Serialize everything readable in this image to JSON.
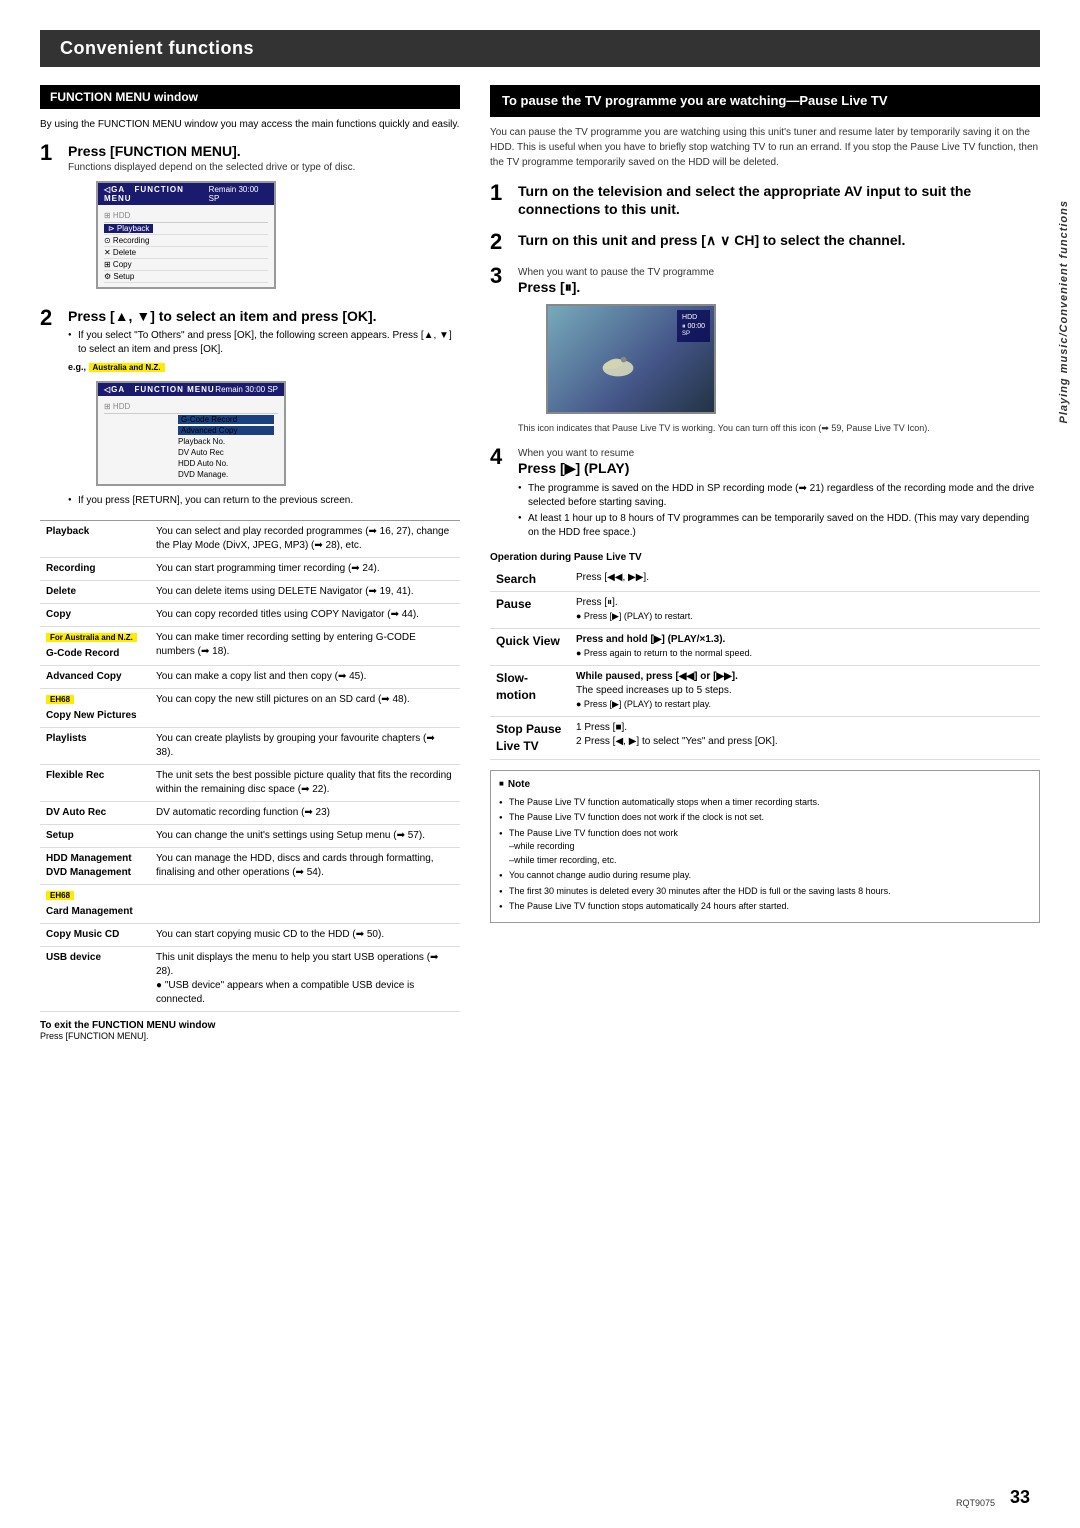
{
  "page": {
    "title": "Convenient functions",
    "page_number": "33",
    "rqt_code": "RQT9075",
    "sidebar_text": "Playing music/Convenient functions"
  },
  "left_section": {
    "heading": "FUNCTION MENU window",
    "intro": "By using the FUNCTION MENU window you may access the main functions quickly and easily.",
    "step1": {
      "number": "1",
      "title": "Press [FUNCTION MENU].",
      "sub": "Functions displayed depend on the selected drive or type of disc."
    },
    "step2": {
      "number": "2",
      "title": "Press [▲, ▼] to select an item and press [OK].",
      "bullet1": "If you select \"To Others\" and press [OK], the following screen appears. Press [▲, ▼] to select an item and press [OK].",
      "eg_label": "e.g., Australia and N.Z.",
      "bullet2": "If you press [RETURN], you can return to the previous screen."
    },
    "screen1": {
      "brand": "◁GA",
      "menu": "FUNCTION MENU",
      "remain": "Remain  30:00 SP",
      "rows": [
        {
          "label": "Playback",
          "highlight": false
        },
        {
          "label": "Recording",
          "highlight": false
        },
        {
          "label": "Delete",
          "highlight": false
        },
        {
          "label": "Copy",
          "highlight": false
        },
        {
          "label": "Setup",
          "highlight": false
        }
      ]
    },
    "screen2": {
      "brand": "◁GA",
      "menu": "FUNCTION MENU",
      "remain": "Remain  30:00 SP",
      "hdd_label": "HDD",
      "rows": [
        {
          "label": "",
          "right_label": "G-Code Record",
          "highlight": false
        },
        {
          "label": "",
          "right_label": "Advanced Copy",
          "highlight_right": true
        },
        {
          "label": "",
          "right_label": "Playback No.",
          "highlight_right": false
        },
        {
          "label": "",
          "right_label": "DV Auto Rec",
          "highlight_right": false
        },
        {
          "label": "",
          "right_label": "HDD Auto No.",
          "highlight_right": false
        },
        {
          "label": "",
          "right_label": "DVD Manage.",
          "highlight_right": false
        }
      ]
    },
    "table": {
      "rows": [
        {
          "label": "Playback",
          "desc": "You can select and play recorded programmes (➡ 16, 27), change the Play Mode (DivX, JPEG, MP3) (➡ 28), etc."
        },
        {
          "label": "Recording",
          "desc": "You can start programming timer recording (➡ 24)."
        },
        {
          "label": "Delete",
          "desc": "You can delete items using DELETE Navigator (➡ 19, 41)."
        },
        {
          "label": "Copy",
          "desc": "You can copy recorded titles using COPY Navigator (➡ 44)."
        },
        {
          "label_special": "For Australia and N.Z.\nG-Code Record",
          "desc": "You can make timer recording setting by entering G-CODE numbers (➡ 18)."
        },
        {
          "label": "Advanced Copy",
          "desc": "You can make a copy list and then copy (➡ 45)."
        },
        {
          "label_special": "EH68\nCopy New Pictures",
          "desc": "You can copy the new still pictures on an SD card (➡ 48)."
        },
        {
          "label": "Playlists",
          "desc": "You can create playlists by grouping your favourite chapters (➡ 38)."
        },
        {
          "label": "Flexible Rec",
          "desc": "The unit sets the best possible picture quality that fits the recording within the remaining disc space (➡ 22)."
        },
        {
          "label": "DV Auto Rec",
          "desc": "DV automatic recording function (➡ 23)"
        },
        {
          "label": "Setup",
          "desc": "You can change the unit's settings using Setup menu (➡ 57)."
        },
        {
          "label": "HDD Management\nDVD Management",
          "desc": "You can manage the HDD, discs and cards through formatting, finalising and other operations (➡ 54)."
        },
        {
          "label_special": "EH68\nCard Management",
          "desc": ""
        },
        {
          "label": "Copy Music CD",
          "desc": "You can start copying music CD to the HDD (➡ 50)."
        },
        {
          "label": "USB device",
          "desc": "This unit displays the menu to help you start USB operations (➡ 28).\n● \"USB device\" appears when a compatible USB device is connected."
        }
      ]
    },
    "footer": {
      "bold": "To exit the FUNCTION MENU window",
      "text": "Press [FUNCTION MENU]."
    }
  },
  "right_section": {
    "heading": "To pause the TV programme you are watching—Pause Live TV",
    "intro": "You can pause the TV programme you are watching using this unit's tuner and resume later by temporarily saving it on the HDD. This is useful when you have to briefly stop watching TV to run an errand. If you stop the Pause Live TV function, then the TV programme temporarily saved on the HDD will be deleted.",
    "step1": {
      "number": "1",
      "title": "Turn on the television and select the appropriate AV input to suit the connections to this unit."
    },
    "step2": {
      "number": "2",
      "title": "Turn on this unit and press [∧ ∨ CH] to select the channel."
    },
    "step3": {
      "number": "3",
      "sub_label": "When you want to pause the TV programme",
      "title": "Press [⏸].",
      "tv_caption": "This icon indicates that Pause Live TV is working. You can turn off this icon (➡ 59, Pause Live TV Icon)."
    },
    "step4": {
      "number": "4",
      "sub_label": "When you want to resume",
      "title": "Press [▶] (PLAY)",
      "bullets": [
        "The programme is saved on the HDD in SP recording mode (➡ 21) regardless of the recording mode and the drive selected before starting saving.",
        "At least 1 hour up to 8 hours of TV programmes can be temporarily saved on the HDD. (This may vary depending on the HDD free space.)"
      ]
    },
    "op_table_header": "Operation during Pause Live TV",
    "op_table": [
      {
        "label": "Search",
        "desc": "Press [◀◀, ▶▶]."
      },
      {
        "label": "Pause",
        "desc": "Press [⏸].\n● Press [▶] (PLAY) to restart."
      },
      {
        "label": "Quick View",
        "desc": "Press and hold [▶] (PLAY/×1.3).\n● Press again to return to the normal speed."
      },
      {
        "label": "Slow-\nmotion",
        "desc": "While paused, press [◀◀] or [▶▶].\nThe speed increases up to 5 steps.\n● Press [▶] (PLAY) to restart play."
      },
      {
        "label": "Stop Pause\nLive TV",
        "desc": "1  Press [■].\n2  Press [◀, ▶] to select \"Yes\" and press [OK]."
      }
    ],
    "note": {
      "title": "Note",
      "items": [
        "The Pause Live TV function automatically stops when a timer recording starts.",
        "The Pause Live TV function does not work if the clock is not set.",
        "The Pause Live TV function does not work\n–while recording\n–while timer recording, etc.",
        "You cannot change audio during resume play.",
        "The first 30 minutes is deleted every 30 minutes after the HDD is full or the saving lasts 8 hours.",
        "The Pause Live TV function stops automatically 24 hours after started."
      ]
    }
  }
}
